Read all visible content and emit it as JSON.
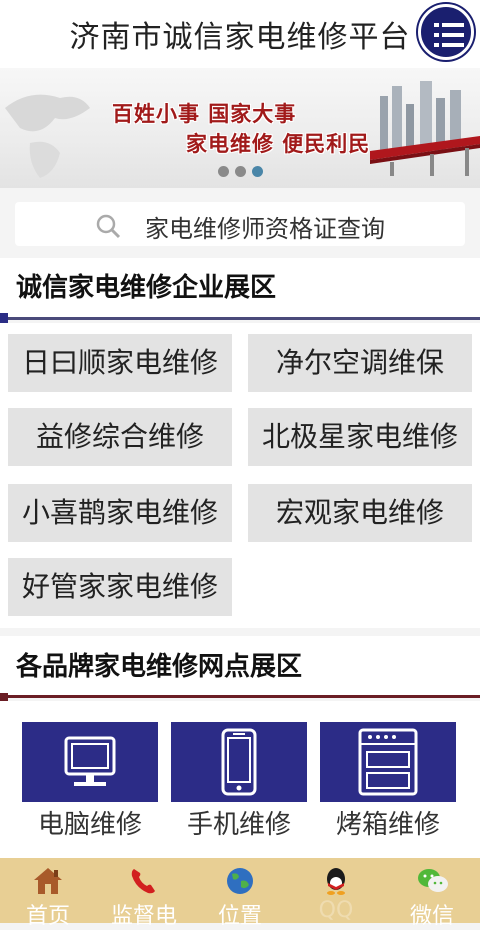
{
  "header": {
    "title": "济南市诚信家电维修平台",
    "menu_icon": "list-menu-icon"
  },
  "banner": {
    "line1": "百姓小事  国家大事",
    "line2": "家电维修  便民利民",
    "slides": 3,
    "active_slide": 3
  },
  "search": {
    "placeholder": "家电维修师资格证查询"
  },
  "section_enterprises": {
    "title": "诚信家电维修企业展区",
    "items": [
      "日曰顺家电维修",
      "净尔空调维保",
      "益修综合维修",
      "北极星家电维修",
      "小喜鹊家电维修",
      "宏观家电维修",
      "好管家家电维修"
    ]
  },
  "section_brands": {
    "title": "各品牌家电维修网点展区",
    "items": [
      {
        "label": "电脑维修",
        "icon": "monitor-icon"
      },
      {
        "label": "手机维修",
        "icon": "phone-icon"
      },
      {
        "label": "烤箱维修",
        "icon": "oven-icon"
      }
    ]
  },
  "tabbar": {
    "items": [
      {
        "label": "首页",
        "icon": "home-icon"
      },
      {
        "label": "监督电",
        "icon": "phone-call-icon"
      },
      {
        "label": "位置",
        "icon": "globe-icon"
      },
      {
        "label": "QQ",
        "icon": "qq-icon"
      },
      {
        "label": "微信",
        "icon": "wechat-icon"
      }
    ]
  },
  "colors": {
    "accent": "#2c2c87",
    "banner_text": "#a11a1a",
    "tabbar": "#e8cf94",
    "brand_divider": "#6a1d24"
  }
}
